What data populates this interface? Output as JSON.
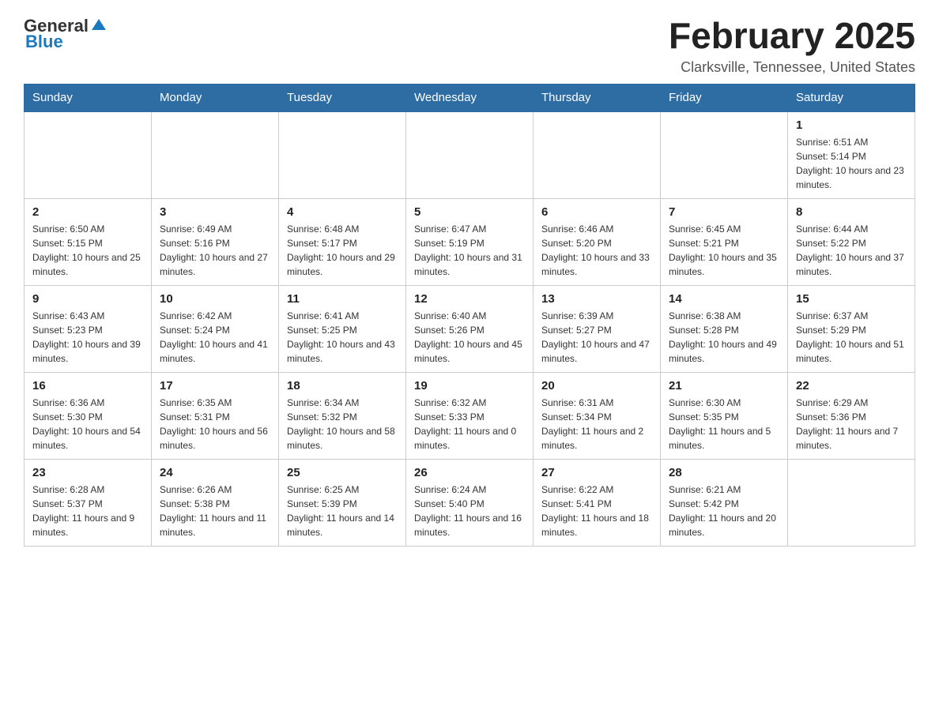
{
  "logo": {
    "general": "General",
    "blue": "Blue"
  },
  "header": {
    "title": "February 2025",
    "location": "Clarksville, Tennessee, United States"
  },
  "days_of_week": [
    "Sunday",
    "Monday",
    "Tuesday",
    "Wednesday",
    "Thursday",
    "Friday",
    "Saturday"
  ],
  "weeks": [
    [
      {
        "day": "",
        "info": ""
      },
      {
        "day": "",
        "info": ""
      },
      {
        "day": "",
        "info": ""
      },
      {
        "day": "",
        "info": ""
      },
      {
        "day": "",
        "info": ""
      },
      {
        "day": "",
        "info": ""
      },
      {
        "day": "1",
        "info": "Sunrise: 6:51 AM\nSunset: 5:14 PM\nDaylight: 10 hours and 23 minutes."
      }
    ],
    [
      {
        "day": "2",
        "info": "Sunrise: 6:50 AM\nSunset: 5:15 PM\nDaylight: 10 hours and 25 minutes."
      },
      {
        "day": "3",
        "info": "Sunrise: 6:49 AM\nSunset: 5:16 PM\nDaylight: 10 hours and 27 minutes."
      },
      {
        "day": "4",
        "info": "Sunrise: 6:48 AM\nSunset: 5:17 PM\nDaylight: 10 hours and 29 minutes."
      },
      {
        "day": "5",
        "info": "Sunrise: 6:47 AM\nSunset: 5:19 PM\nDaylight: 10 hours and 31 minutes."
      },
      {
        "day": "6",
        "info": "Sunrise: 6:46 AM\nSunset: 5:20 PM\nDaylight: 10 hours and 33 minutes."
      },
      {
        "day": "7",
        "info": "Sunrise: 6:45 AM\nSunset: 5:21 PM\nDaylight: 10 hours and 35 minutes."
      },
      {
        "day": "8",
        "info": "Sunrise: 6:44 AM\nSunset: 5:22 PM\nDaylight: 10 hours and 37 minutes."
      }
    ],
    [
      {
        "day": "9",
        "info": "Sunrise: 6:43 AM\nSunset: 5:23 PM\nDaylight: 10 hours and 39 minutes."
      },
      {
        "day": "10",
        "info": "Sunrise: 6:42 AM\nSunset: 5:24 PM\nDaylight: 10 hours and 41 minutes."
      },
      {
        "day": "11",
        "info": "Sunrise: 6:41 AM\nSunset: 5:25 PM\nDaylight: 10 hours and 43 minutes."
      },
      {
        "day": "12",
        "info": "Sunrise: 6:40 AM\nSunset: 5:26 PM\nDaylight: 10 hours and 45 minutes."
      },
      {
        "day": "13",
        "info": "Sunrise: 6:39 AM\nSunset: 5:27 PM\nDaylight: 10 hours and 47 minutes."
      },
      {
        "day": "14",
        "info": "Sunrise: 6:38 AM\nSunset: 5:28 PM\nDaylight: 10 hours and 49 minutes."
      },
      {
        "day": "15",
        "info": "Sunrise: 6:37 AM\nSunset: 5:29 PM\nDaylight: 10 hours and 51 minutes."
      }
    ],
    [
      {
        "day": "16",
        "info": "Sunrise: 6:36 AM\nSunset: 5:30 PM\nDaylight: 10 hours and 54 minutes."
      },
      {
        "day": "17",
        "info": "Sunrise: 6:35 AM\nSunset: 5:31 PM\nDaylight: 10 hours and 56 minutes."
      },
      {
        "day": "18",
        "info": "Sunrise: 6:34 AM\nSunset: 5:32 PM\nDaylight: 10 hours and 58 minutes."
      },
      {
        "day": "19",
        "info": "Sunrise: 6:32 AM\nSunset: 5:33 PM\nDaylight: 11 hours and 0 minutes."
      },
      {
        "day": "20",
        "info": "Sunrise: 6:31 AM\nSunset: 5:34 PM\nDaylight: 11 hours and 2 minutes."
      },
      {
        "day": "21",
        "info": "Sunrise: 6:30 AM\nSunset: 5:35 PM\nDaylight: 11 hours and 5 minutes."
      },
      {
        "day": "22",
        "info": "Sunrise: 6:29 AM\nSunset: 5:36 PM\nDaylight: 11 hours and 7 minutes."
      }
    ],
    [
      {
        "day": "23",
        "info": "Sunrise: 6:28 AM\nSunset: 5:37 PM\nDaylight: 11 hours and 9 minutes."
      },
      {
        "day": "24",
        "info": "Sunrise: 6:26 AM\nSunset: 5:38 PM\nDaylight: 11 hours and 11 minutes."
      },
      {
        "day": "25",
        "info": "Sunrise: 6:25 AM\nSunset: 5:39 PM\nDaylight: 11 hours and 14 minutes."
      },
      {
        "day": "26",
        "info": "Sunrise: 6:24 AM\nSunset: 5:40 PM\nDaylight: 11 hours and 16 minutes."
      },
      {
        "day": "27",
        "info": "Sunrise: 6:22 AM\nSunset: 5:41 PM\nDaylight: 11 hours and 18 minutes."
      },
      {
        "day": "28",
        "info": "Sunrise: 6:21 AM\nSunset: 5:42 PM\nDaylight: 11 hours and 20 minutes."
      },
      {
        "day": "",
        "info": ""
      }
    ]
  ]
}
